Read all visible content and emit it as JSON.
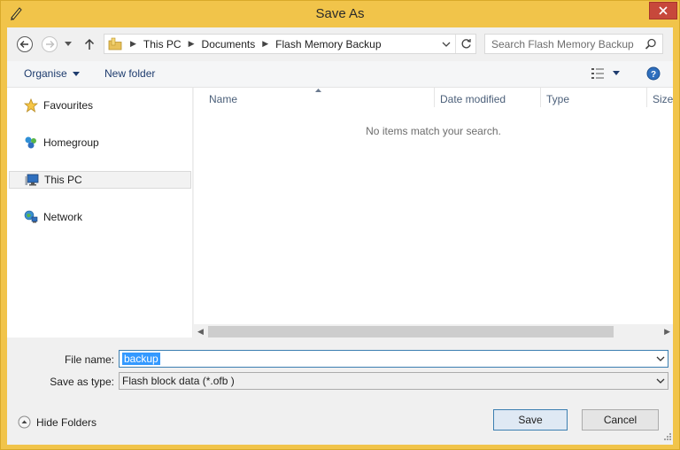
{
  "window": {
    "title": "Save As",
    "accent": "#f1c44a",
    "close_color": "#c7483b"
  },
  "address": {
    "crumbs": [
      "This PC",
      "Documents",
      "Flash Memory Backup"
    ]
  },
  "search": {
    "placeholder": "Search Flash Memory Backup"
  },
  "toolbar": {
    "organise_label": "Organise",
    "new_folder_label": "New folder"
  },
  "sidebar": {
    "items": [
      {
        "label": "Favourites",
        "icon": "star-icon"
      },
      {
        "label": "Homegroup",
        "icon": "homegroup-icon"
      },
      {
        "label": "This PC",
        "icon": "computer-icon",
        "selected": true
      },
      {
        "label": "Network",
        "icon": "network-icon"
      }
    ]
  },
  "file_list": {
    "columns": [
      "Name",
      "Date modified",
      "Type",
      "Size"
    ],
    "empty_message": "No items match your search."
  },
  "form": {
    "file_name_label": "File name:",
    "file_name_value": "backup",
    "save_type_label": "Save as type:",
    "save_type_value": "Flash block data (*.ofb )"
  },
  "footer": {
    "hide_folders_label": "Hide Folders",
    "save_label": "Save",
    "cancel_label": "Cancel"
  }
}
